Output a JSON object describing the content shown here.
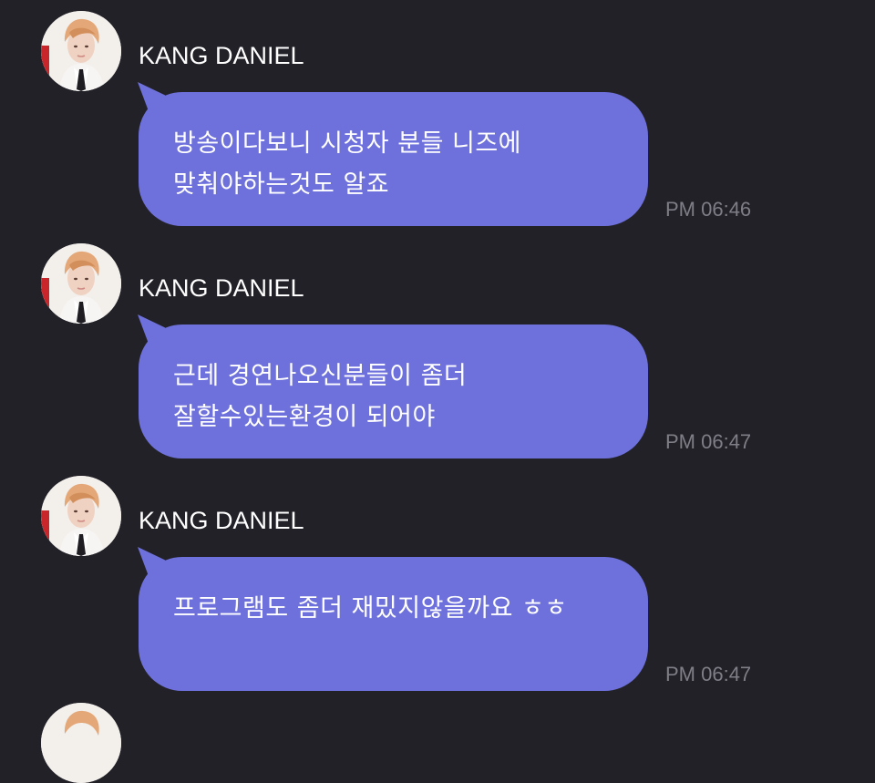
{
  "chat": {
    "messages": [
      {
        "sender": "KANG DANIEL",
        "text": "방송이다보니 시청자 분들 니즈에 맞춰야하는것도 알죠",
        "time": "PM 06:46",
        "avatar_icon": "profile-photo"
      },
      {
        "sender": "KANG DANIEL",
        "text": "근데 경연나오신분들이 좀더 잘할수있는환경이 되어야",
        "time": "PM 06:47",
        "avatar_icon": "profile-photo"
      },
      {
        "sender": "KANG DANIEL",
        "text": "프로그램도 좀더 재밌지않을까요 ㅎㅎ",
        "time": "PM 06:47",
        "avatar_icon": "profile-photo"
      }
    ]
  },
  "colors": {
    "background": "#222128",
    "bubble": "#6e71db",
    "sender_text": "#ffffff",
    "timestamp": "#7f7d86"
  }
}
